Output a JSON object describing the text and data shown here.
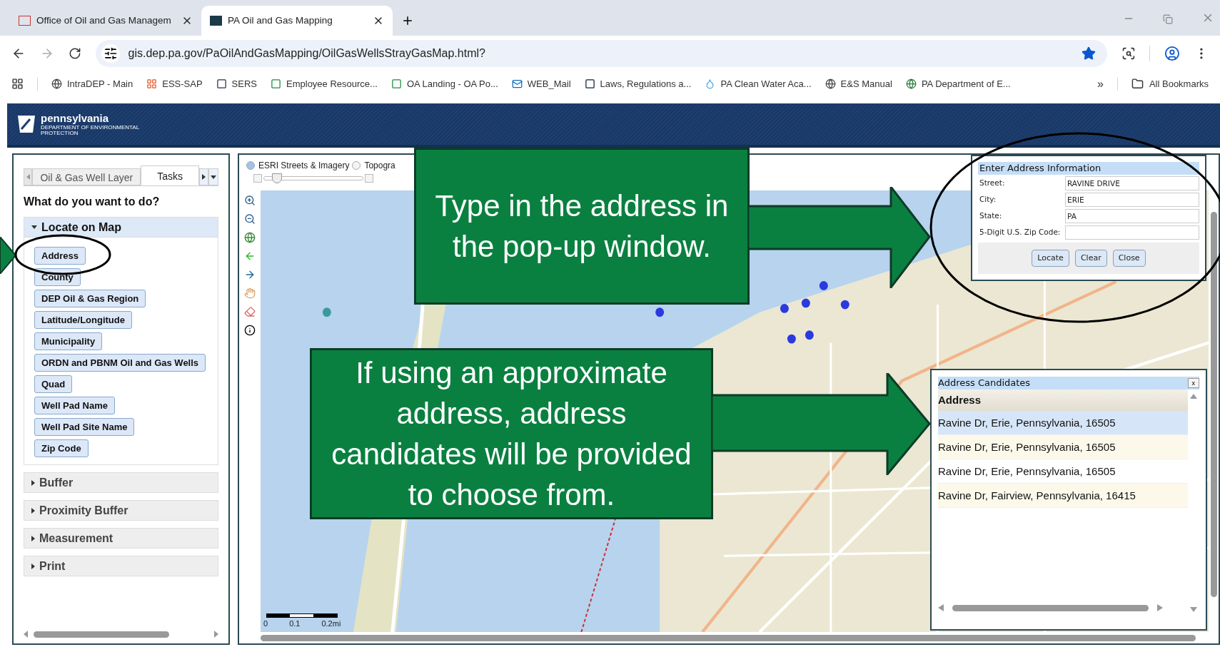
{
  "browser": {
    "tabs": [
      {
        "title": "Office of Oil and Gas Managem",
        "selected": false
      },
      {
        "title": "PA Oil and Gas Mapping",
        "selected": true
      }
    ],
    "url": "gis.dep.pa.gov/PaOilAndGasMapping/OilGasWellsStrayGasMap.html?",
    "bookmarks": [
      "IntraDEP - Main",
      "ESS-SAP",
      "SERS",
      "Employee Resource...",
      "OA Landing - OA Po...",
      "WEB_Mail",
      "Laws, Regulations a...",
      "PA Clean Water Aca...",
      "E&S Manual",
      "PA Department of E..."
    ],
    "bookmarks_overflow": "»",
    "all_bookmarks": "All Bookmarks"
  },
  "header": {
    "logo_name": "pennsylvania",
    "logo_subtitle": "DEPARTMENT OF ENVIRONMENTAL PROTECTION"
  },
  "left_panel": {
    "tabs": [
      {
        "label": "Oil & Gas Well Layer",
        "selected": false
      },
      {
        "label": "Tasks",
        "selected": true
      }
    ],
    "question": "What do you want to do?",
    "sections": [
      {
        "title": "Locate on Map",
        "expanded": true,
        "buttons": [
          "Address",
          "County",
          "DEP Oil & Gas Region",
          "Latitude/Longitude",
          "Municipality",
          "ORDN and PBNM Oil and Gas Wells",
          "Quad",
          "Well Pad Name",
          "Well Pad Site Name",
          "Zip Code"
        ]
      },
      {
        "title": "Buffer",
        "expanded": false
      },
      {
        "title": "Proximity Buffer",
        "expanded": false
      },
      {
        "title": "Measurement",
        "expanded": false
      },
      {
        "title": "Print",
        "expanded": false
      }
    ]
  },
  "map": {
    "basemaps": [
      {
        "label": "ESRI Streets & Imagery",
        "selected": true
      },
      {
        "label": "Topogra",
        "selected": false
      }
    ],
    "opacity_slider": {
      "level": 0.08
    },
    "scale_labels": [
      "0",
      "0.1",
      "0.2mi"
    ]
  },
  "address_dialog": {
    "title": "Enter Address Information",
    "fields": [
      {
        "label": "Street:",
        "value": "RAVINE DRIVE"
      },
      {
        "label": "City:",
        "value": "ERIE"
      },
      {
        "label": "State:",
        "value": "PA"
      },
      {
        "label": "5-Digit U.S. Zip Code:"
      }
    ],
    "buttons": [
      "Locate",
      "Clear",
      "Close"
    ]
  },
  "candidates_dialog": {
    "title": "Address Candidates",
    "close": "x",
    "column": "Address",
    "rows": [
      {
        "address": "Ravine Dr, Erie, Pennsylvania, 16505",
        "selected": true
      },
      {
        "address": "Ravine Dr, Erie, Pennsylvania, 16505",
        "selected": false
      },
      {
        "address": "Ravine Dr, Erie, Pennsylvania, 16505",
        "selected": false
      },
      {
        "address": "Ravine Dr, Fairview, Pennsylvania, 16415",
        "selected": false
      }
    ]
  },
  "callouts": [
    "Type in the address in the pop-up window.",
    "If using an approximate address, address candidates will be provided to choose from."
  ]
}
